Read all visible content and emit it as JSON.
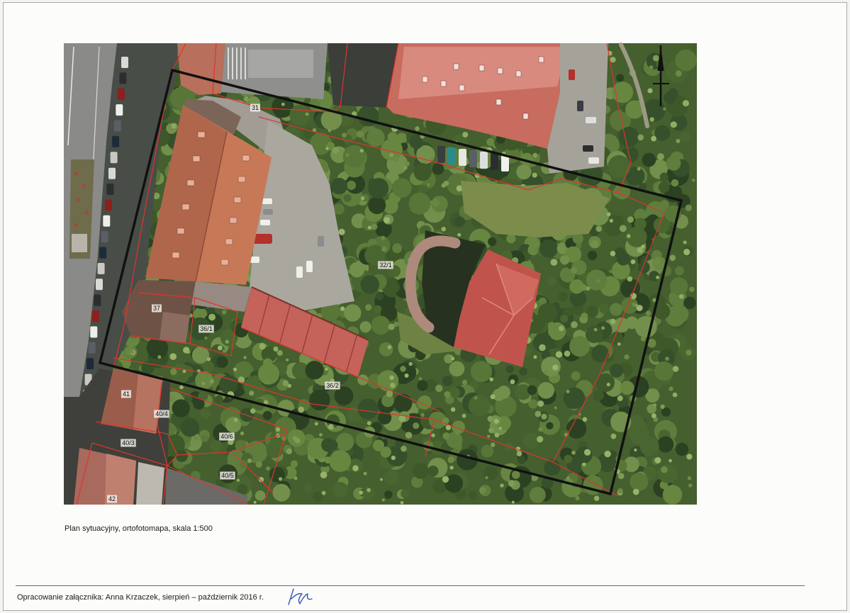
{
  "document": {
    "caption": "Plan sytuacyjny, ortofotomapa, skala 1:500",
    "footer": "Opracowanie załącznika: Anna Krzaczek, sierpień – październik 2016 r."
  },
  "map": {
    "parcels": [
      "31",
      "32/1",
      "37",
      "36/1",
      "36/2",
      "41",
      "40/4",
      "40/3",
      "40/6",
      "40/5",
      "42"
    ],
    "icons": {
      "north_arrow": "north-arrow-icon"
    },
    "colors": {
      "parcel_lines": "#e0342e",
      "site_boundary": "#111111",
      "signature_ink": "#3d52b5"
    }
  }
}
